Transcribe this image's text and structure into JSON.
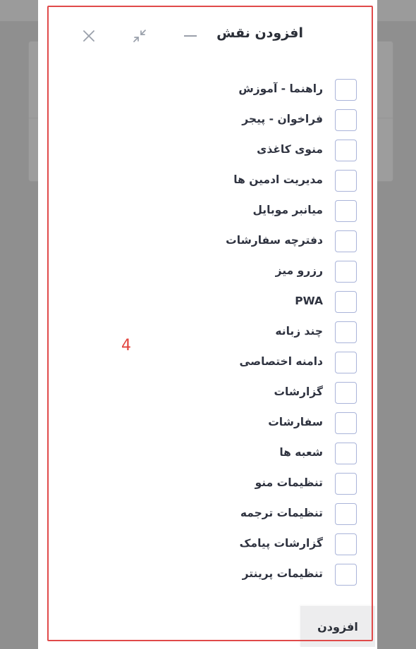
{
  "dialog": {
    "title": "افزودن نقش",
    "submit_label": "افزودن"
  },
  "permissions": [
    {
      "label": "راهنما - آموزش",
      "checked": false
    },
    {
      "label": "فراخوان - پیجر",
      "checked": false
    },
    {
      "label": "منوی کاغذی",
      "checked": false
    },
    {
      "label": "مدیریت ادمین ها",
      "checked": false
    },
    {
      "label": "میانبر موبایل",
      "checked": false
    },
    {
      "label": "دفترچه سفارشات",
      "checked": false
    },
    {
      "label": "رزرو میز",
      "checked": false
    },
    {
      "label": "PWA",
      "checked": false
    },
    {
      "label": "چند زبانه",
      "checked": false
    },
    {
      "label": "دامنه اختصاصی",
      "checked": false
    },
    {
      "label": "گزارشات",
      "checked": false
    },
    {
      "label": "سفارشات",
      "checked": false
    },
    {
      "label": "شعبه ها",
      "checked": false
    },
    {
      "label": "تنظیمات منو",
      "checked": false
    },
    {
      "label": "تنظیمات ترجمه",
      "checked": false
    },
    {
      "label": "گزارشات پیامک",
      "checked": false
    },
    {
      "label": "تنظیمات پرینتر",
      "checked": false
    }
  ],
  "annotation": {
    "number": "4",
    "color": "#e04a4a"
  },
  "icons": {
    "minimize": "minimize-icon",
    "collapse": "collapse-icon",
    "close": "close-icon"
  }
}
